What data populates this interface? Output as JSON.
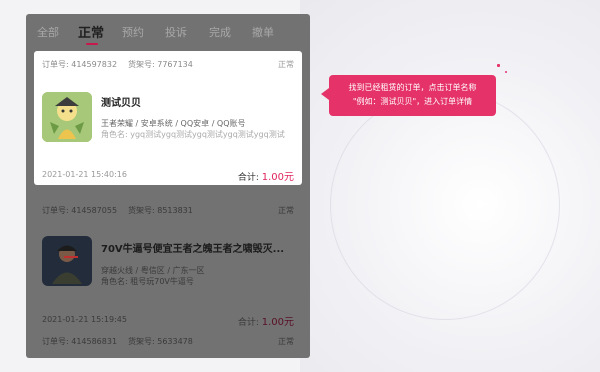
{
  "tabs": [
    {
      "label": "全部"
    },
    {
      "label": "正常"
    },
    {
      "label": "预约"
    },
    {
      "label": "投诉"
    },
    {
      "label": "完成"
    },
    {
      "label": "撤单"
    }
  ],
  "orders": [
    {
      "order_no": "订单号: 414597832",
      "shelf_no": "货架号: 7767134",
      "status": "正常",
      "title": "测试贝贝",
      "sub": "王者荣耀 / 安卓系统 / QQ安卓 / QQ账号",
      "role": "角色名: ygq测试ygq测试ygq测试ygq测试ygq测试",
      "time": "2021-01-21 15:40:16",
      "total_label": "合计: ",
      "amount": "1.00元"
    },
    {
      "order_no": "订单号: 414587055",
      "shelf_no": "货架号: 8513831",
      "status": "正常",
      "title": "70V牛逼号便宜王者之魄王者之啸毁灭...",
      "sub": "穿越火线 / 粤信区 / 广东一区",
      "role": "角色名: 租号玩70V牛逼号",
      "time": "2021-01-21 15:19:45",
      "total_label": "合计: ",
      "amount": "1.00元"
    },
    {
      "order_no": "订单号: 414586831",
      "shelf_no": "货架号: 5633478",
      "status": "正常"
    }
  ],
  "tooltip": {
    "line1": "找到已经租赁的订单，点击订单名称",
    "line2": "\"例如：测试贝贝\"，进入订单详情"
  },
  "icons": {
    "thumb1": "game-character-avatar-icon",
    "thumb2": "soldier-avatar-icon"
  },
  "colors": {
    "accent": "#e0245e",
    "tooltip_bg": "#e5336a",
    "overlay": "#727272"
  }
}
